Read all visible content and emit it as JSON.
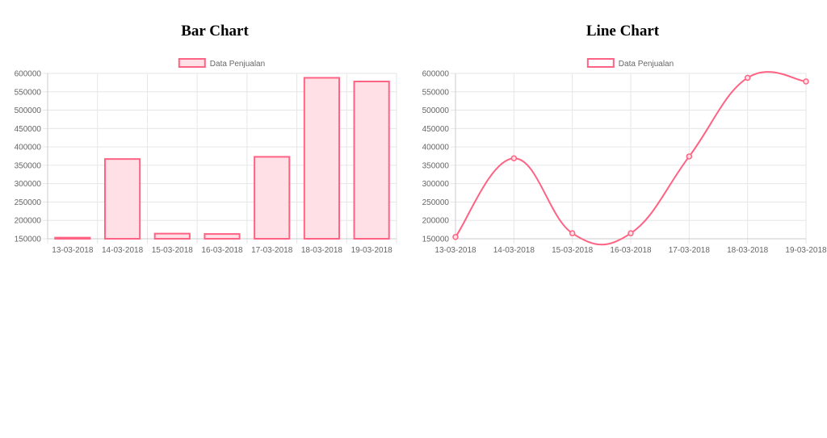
{
  "bar_chart": {
    "title": "Bar Chart",
    "legend_label": "Data Penjualan"
  },
  "line_chart": {
    "title": "Line Chart",
    "legend_label": "Data Penjualan"
  },
  "colors": {
    "stroke": "#ff6384",
    "fill": "#ffe0e6",
    "grid": "#e6e6e6",
    "tick_text": "#666666"
  },
  "chart_data": [
    {
      "type": "bar",
      "title": "Bar Chart",
      "categories": [
        "13-03-2018",
        "14-03-2018",
        "15-03-2018",
        "16-03-2018",
        "17-03-2018",
        "18-03-2018",
        "19-03-2018"
      ],
      "series": [
        {
          "name": "Data Penjualan",
          "values": [
            153000,
            367000,
            164000,
            163000,
            373000,
            588000,
            578000
          ]
        }
      ],
      "ylim": [
        150000,
        600000
      ],
      "yticks": [
        150000,
        200000,
        250000,
        300000,
        350000,
        400000,
        450000,
        500000,
        550000,
        600000
      ],
      "grid": true,
      "legend": "top-center"
    },
    {
      "type": "line",
      "title": "Line Chart",
      "categories": [
        "13-03-2018",
        "14-03-2018",
        "15-03-2018",
        "16-03-2018",
        "17-03-2018",
        "18-03-2018",
        "19-03-2018"
      ],
      "series": [
        {
          "name": "Data Penjualan",
          "values": [
            155000,
            369000,
            165000,
            165000,
            374000,
            588000,
            578000
          ]
        }
      ],
      "ylim": [
        150000,
        600000
      ],
      "yticks": [
        150000,
        200000,
        250000,
        300000,
        350000,
        400000,
        450000,
        500000,
        550000,
        600000
      ],
      "grid": true,
      "legend": "top-center"
    }
  ]
}
